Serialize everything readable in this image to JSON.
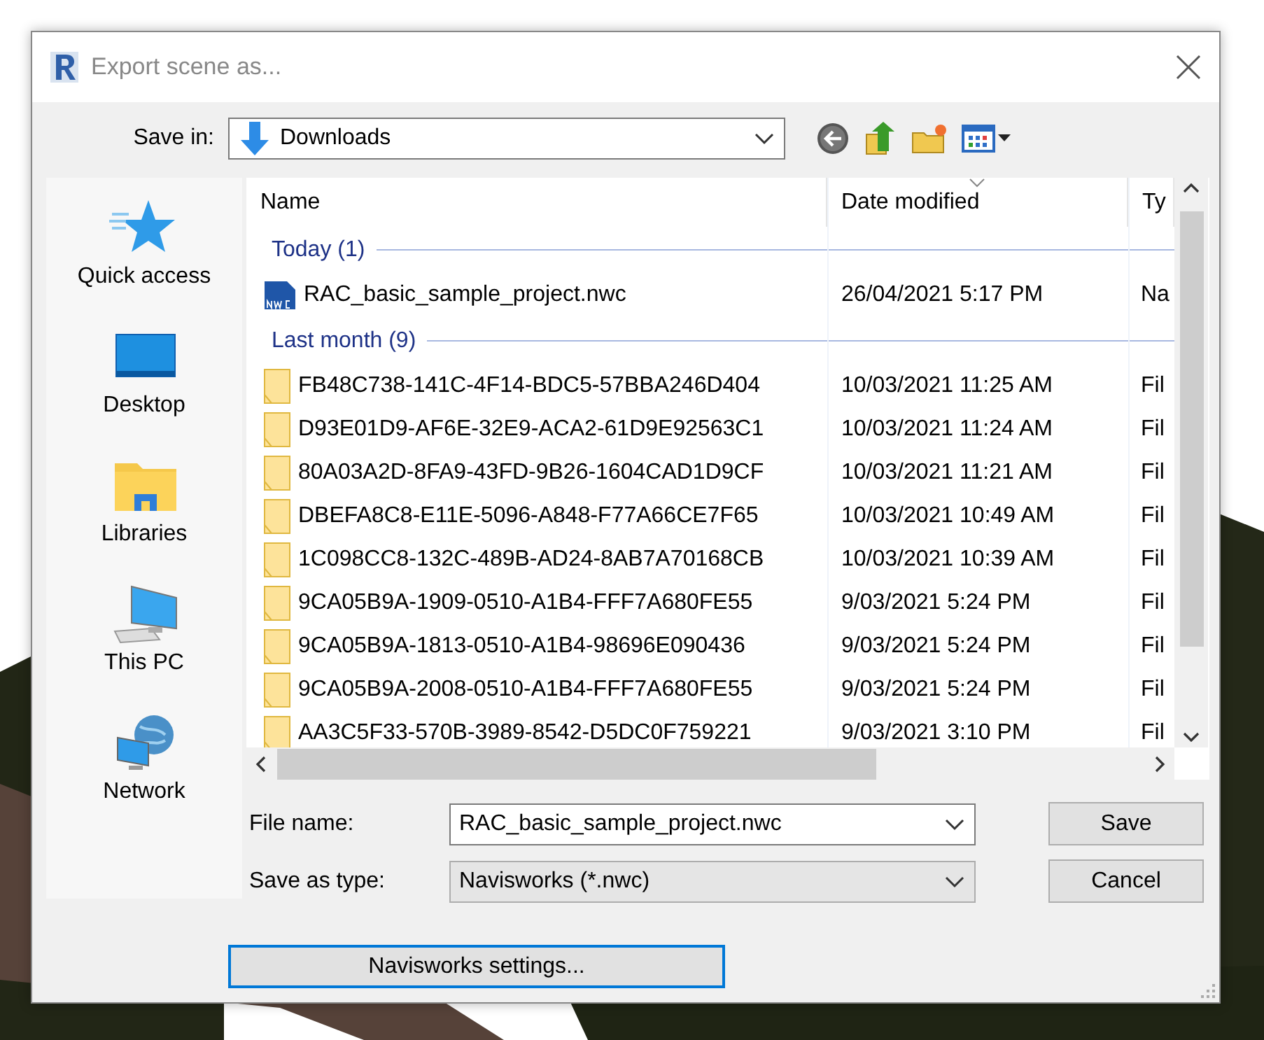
{
  "window": {
    "title": "Export scene as..."
  },
  "save_in": {
    "label": "Save in:",
    "value": "Downloads"
  },
  "sidebar": {
    "items": [
      {
        "label": "Quick access",
        "kind": "star"
      },
      {
        "label": "Desktop",
        "kind": "desktop"
      },
      {
        "label": "Libraries",
        "kind": "libraries"
      },
      {
        "label": "This PC",
        "kind": "pc"
      },
      {
        "label": "Network",
        "kind": "network"
      }
    ]
  },
  "file_list": {
    "columns": [
      {
        "label": "Name",
        "sorted": false
      },
      {
        "label": "Date modified",
        "sorted": true
      },
      {
        "label": "Ty",
        "sorted": false
      }
    ],
    "groups": [
      {
        "label": "Today (1)",
        "rows": [
          {
            "kind": "nwc",
            "name": "RAC_basic_sample_project.nwc",
            "date": "26/04/2021 5:17 PM",
            "type": "Na"
          }
        ]
      },
      {
        "label": "Last month (9)",
        "rows": [
          {
            "kind": "folder",
            "name": "FB48C738-141C-4F14-BDC5-57BBA246D404",
            "date": "10/03/2021 11:25 AM",
            "type": "Fil"
          },
          {
            "kind": "folder",
            "name": "D93E01D9-AF6E-32E9-ACA2-61D9E92563C1",
            "date": "10/03/2021 11:24 AM",
            "type": "Fil"
          },
          {
            "kind": "folder",
            "name": "80A03A2D-8FA9-43FD-9B26-1604CAD1D9CF",
            "date": "10/03/2021 11:21 AM",
            "type": "Fil"
          },
          {
            "kind": "folder",
            "name": "DBEFA8C8-E11E-5096-A848-F77A66CE7F65",
            "date": "10/03/2021 10:49 AM",
            "type": "Fil"
          },
          {
            "kind": "folder",
            "name": "1C098CC8-132C-489B-AD24-8AB7A70168CB",
            "date": "10/03/2021 10:39 AM",
            "type": "Fil"
          },
          {
            "kind": "folder",
            "name": "9CA05B9A-1909-0510-A1B4-FFF7A680FE55",
            "date": "9/03/2021 5:24 PM",
            "type": "Fil"
          },
          {
            "kind": "folder",
            "name": "9CA05B9A-1813-0510-A1B4-98696E090436",
            "date": "9/03/2021 5:24 PM",
            "type": "Fil"
          },
          {
            "kind": "folder",
            "name": "9CA05B9A-2008-0510-A1B4-FFF7A680FE55",
            "date": "9/03/2021 5:24 PM",
            "type": "Fil"
          },
          {
            "kind": "folder",
            "name": "AA3C5F33-570B-3989-8542-D5DC0F759221",
            "date": "9/03/2021 3:10 PM",
            "type": "Fil"
          }
        ]
      }
    ]
  },
  "file_name": {
    "label": "File name:",
    "value": "RAC_basic_sample_project.nwc"
  },
  "save_as_type": {
    "label": "Save as type:",
    "value": "Navisworks (*.nwc)"
  },
  "buttons": [
    {
      "label": "Save",
      "focused": false
    },
    {
      "label": "Cancel",
      "focused": false
    }
  ],
  "settings_button": {
    "label": "Navisworks settings...",
    "focused": true
  }
}
